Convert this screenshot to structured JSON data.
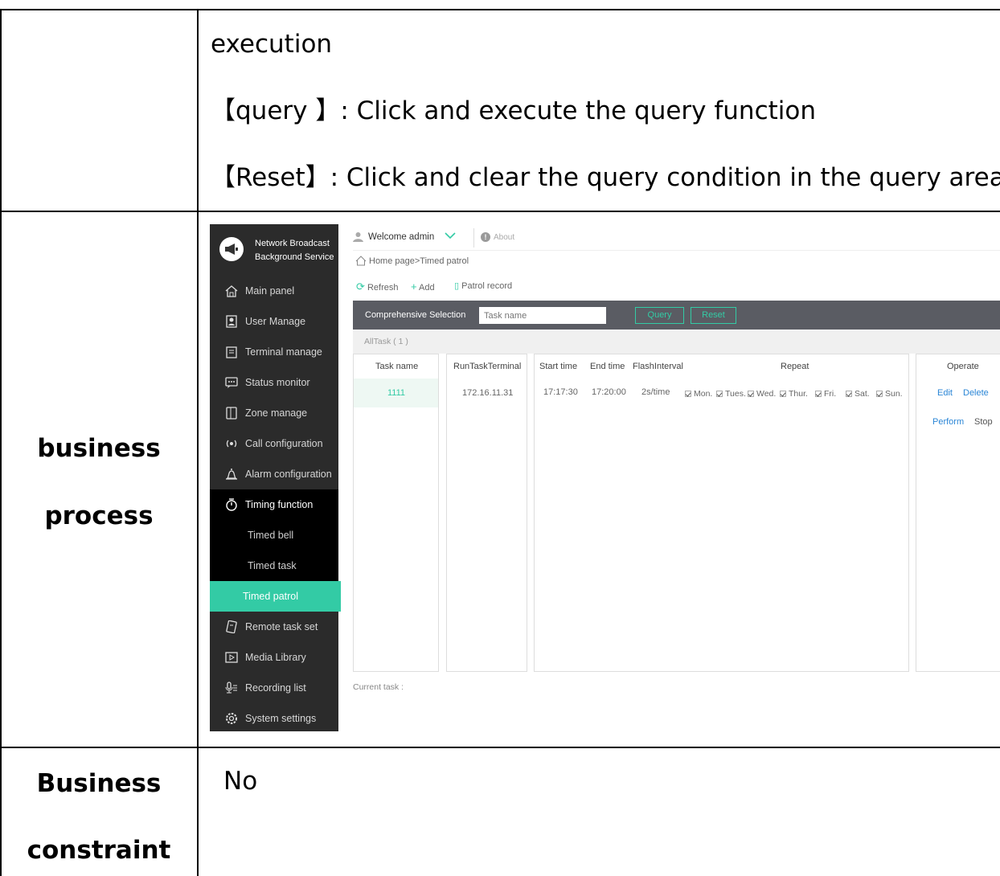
{
  "doc": {
    "top_row": {
      "line1": "execution",
      "line2": "【query 】: Click and execute the query function",
      "line3": "【Reset】: Click and clear the query condition in the query area"
    },
    "process_label": [
      "business",
      "process"
    ],
    "constraint_label": [
      "Business",
      "constraint"
    ],
    "constraint_value": "No"
  },
  "app": {
    "brand": {
      "line1": "Network Broadcast",
      "line2": "Background Service"
    },
    "nav": [
      {
        "label": "Main panel",
        "icon": "home-icon"
      },
      {
        "label": "User Manage",
        "icon": "user-manage-icon"
      },
      {
        "label": "Terminal manage",
        "icon": "terminal-icon"
      },
      {
        "label": "Status monitor",
        "icon": "monitor-icon"
      },
      {
        "label": "Zone manage",
        "icon": "zone-icon"
      },
      {
        "label": "Call configuration",
        "icon": "broadcast-icon"
      },
      {
        "label": "Alarm configuration",
        "icon": "bell-icon"
      },
      {
        "label": "Timing function",
        "icon": "timer-icon"
      }
    ],
    "sub_nav": [
      "Timed bell",
      "Timed task",
      "Timed patrol"
    ],
    "nav_bottom": [
      {
        "label": "Remote task set",
        "icon": "remote-task-icon"
      },
      {
        "label": "Media Library",
        "icon": "media-icon"
      },
      {
        "label": "Recording list",
        "icon": "microphone-icon"
      },
      {
        "label": "System settings",
        "icon": "gear-icon"
      }
    ],
    "topbar": {
      "welcome": "Welcome admin",
      "about": "About"
    },
    "breadcrumb": "Home page>Timed patrol",
    "toolbar": {
      "refresh": "Refresh",
      "add": "Add",
      "patrol_record": "Patrol record"
    },
    "filter": {
      "label": "Comprehensive Selection",
      "placeholder": "Task name",
      "query": "Query",
      "reset": "Reset"
    },
    "count": "AllTask ( 1 )",
    "table": {
      "headers": {
        "task_name": "Task name",
        "terminal": "RunTaskTerminal",
        "start": "Start time",
        "end": "End time",
        "interval": "FlashInterval",
        "repeat": "Repeat",
        "operate": "Operate"
      },
      "row": {
        "task_name": "1111",
        "terminal": "172.16.11.31",
        "start": "17:17:30",
        "end": "17:20:00",
        "interval": "2s/time",
        "days": [
          "Mon.",
          "Tues.",
          "Wed.",
          "Thur.",
          "Fri.",
          "Sat.",
          "Sun."
        ]
      },
      "ops": {
        "edit": "Edit",
        "delete": "Delete",
        "perform": "Perform",
        "stop": "Stop"
      }
    },
    "current_task": "Current task :"
  }
}
